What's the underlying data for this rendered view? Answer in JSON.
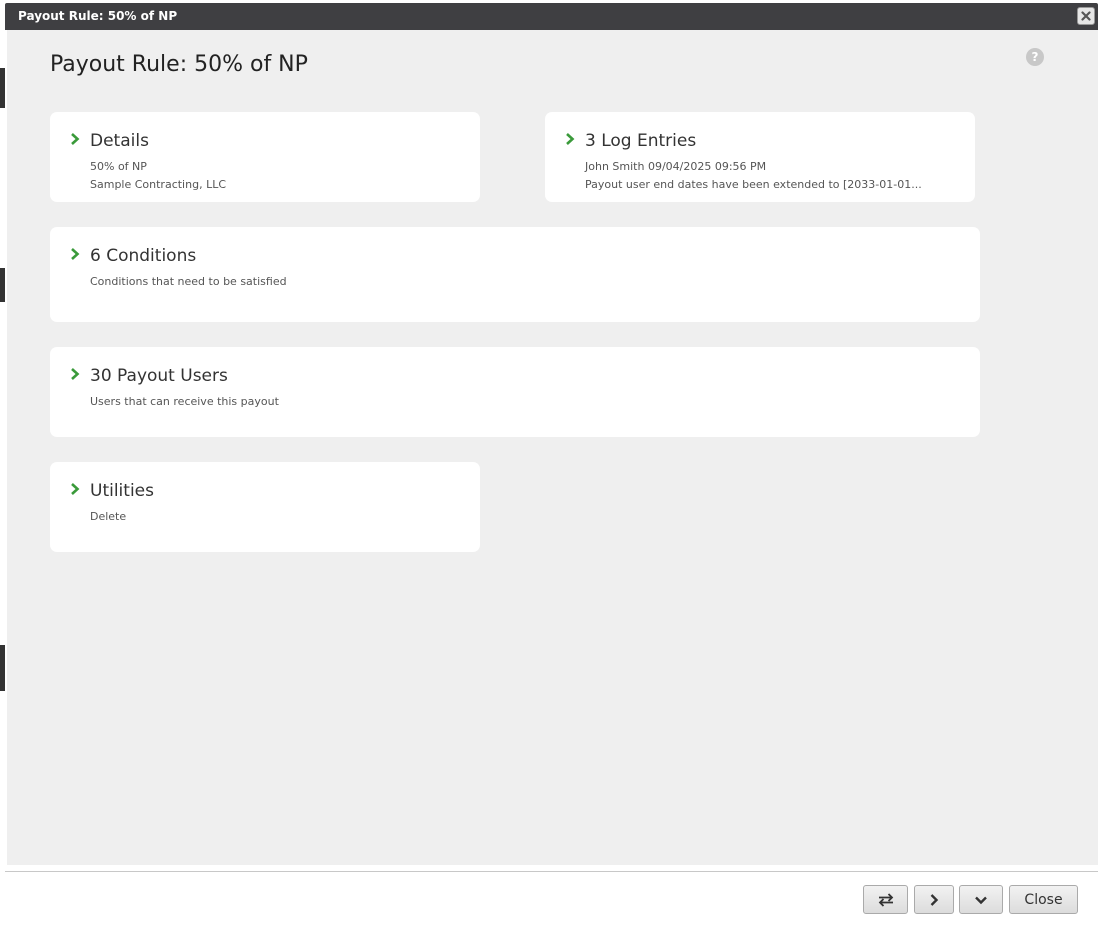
{
  "window": {
    "title": "Payout Rule: 50% of NP"
  },
  "page": {
    "title": "Payout Rule: 50% of NP"
  },
  "cards": {
    "details": {
      "title": "Details",
      "line1": "50% of NP",
      "line2": "Sample Contracting, LLC"
    },
    "log_entries": {
      "title": "3 Log Entries",
      "line1": "John Smith  09/04/2025 09:56 PM",
      "line2": "Payout user end dates have been extended to [2033-01-01..."
    },
    "conditions": {
      "title": "6 Conditions",
      "line1": "Conditions that need to be satisfied"
    },
    "payout_users": {
      "title": "30 Payout Users",
      "line1": "Users that can receive this payout"
    },
    "utilities": {
      "title": "Utilities",
      "line1": "Delete"
    }
  },
  "footer": {
    "close_label": "Close"
  },
  "icons": {
    "close": "close-icon",
    "help": "help-icon",
    "chevron": "chevron-right-icon",
    "swap": "swap-icon",
    "next": "chevron-right-icon",
    "expand": "chevron-down-icon"
  },
  "colors": {
    "accent": "#3a9a3a",
    "titlebar": "#3f3f42",
    "panel": "#efefef"
  }
}
